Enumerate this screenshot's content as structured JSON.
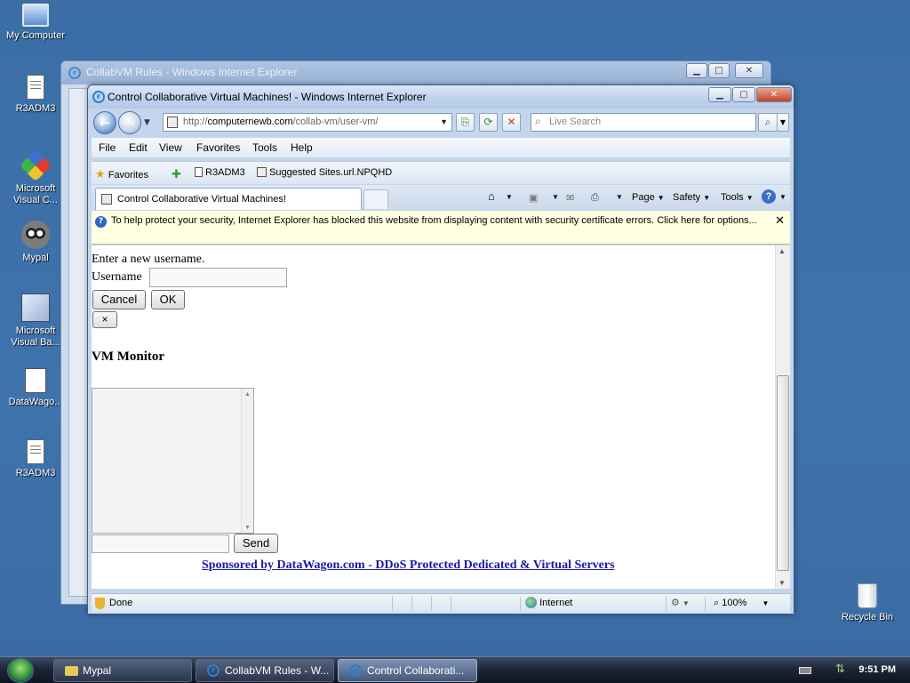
{
  "desktop": {
    "icons": [
      {
        "label": "My Computer"
      },
      {
        "label": "R3ADM3"
      },
      {
        "label": "Microsoft Visual C..."
      },
      {
        "label": "Mypal"
      },
      {
        "label": "Microsoft Visual Ba..."
      },
      {
        "label": "DataWago..."
      },
      {
        "label": "R3ADM3"
      },
      {
        "label": "Recycle Bin"
      }
    ]
  },
  "back_window": {
    "title": "CollabVM Rules - Windows Internet Explorer"
  },
  "ie": {
    "title": "Control Collaborative Virtual Machines! - Windows Internet Explorer",
    "address_prefix": "http://",
    "address_domain": "computernewb.com",
    "address_path": "/collab-vm/user-vm/",
    "search_placeholder": "Live Search",
    "menu": [
      "File",
      "Edit",
      "View",
      "Favorites",
      "Tools",
      "Help"
    ],
    "favorites": {
      "label": "Favorites",
      "items": [
        "R3ADM3",
        "Suggested Sites.url.NPQHD"
      ]
    },
    "tab_title": "Control Collaborative Virtual Machines!",
    "commands": {
      "page": "Page",
      "safety": "Safety",
      "tools": "Tools"
    },
    "infobar": "To help protect your security, Internet Explorer has blocked this website from displaying content with security certificate errors. Click here for options...",
    "status": {
      "left": "Done",
      "zone": "Internet",
      "zoom": "100%"
    }
  },
  "page": {
    "prompt": "Enter a new username.",
    "username_label": "Username",
    "username_value": "",
    "cancel_label": "Cancel",
    "ok_label": "OK",
    "close_label": "×",
    "monitor_heading": "VM Monitor",
    "chat_value": "",
    "send_label": "Send",
    "sponsor": "Sponsored by DataWagon.com - DDoS Protected Dedicated & Virtual Servers"
  },
  "taskbar": {
    "items": [
      {
        "label": "Mypal",
        "active": false
      },
      {
        "label": "CollabVM Rules - W...",
        "active": false
      },
      {
        "label": "Control Collaborati...",
        "active": true
      }
    ],
    "clock": "9:51 PM"
  }
}
